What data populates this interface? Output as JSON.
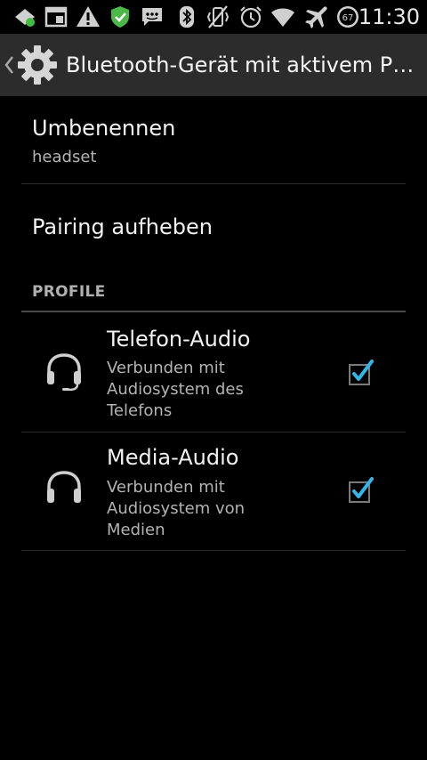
{
  "status_bar": {
    "time": "11:30",
    "battery_level": "67",
    "icons": [
      "notification-icon",
      "screenshot-icon",
      "warning-icon",
      "shield-icon",
      "messaging-icon",
      "bluetooth-icon",
      "vibrate-icon",
      "alarm-icon",
      "wifi-icon",
      "airplane-icon",
      "battery-icon"
    ]
  },
  "action_bar": {
    "title": "Bluetooth-Gerät mit aktivem P…"
  },
  "rename": {
    "title": "Umbenennen",
    "summary": "headset"
  },
  "unpair": {
    "title": "Pairing aufheben"
  },
  "profiles": {
    "category_label": "PROFILE",
    "items": [
      {
        "title": "Telefon-Audio",
        "summary": "Verbunden mit\nAudiosystem des\nTelefons",
        "icon": "headset-icon",
        "checked": true
      },
      {
        "title": "Media-Audio",
        "summary": "Verbunden mit\nAudiosystem von\nMedien",
        "icon": "headphones-icon",
        "checked": true
      }
    ]
  },
  "colors": {
    "action_bar_bg": "#2c2c2c",
    "accent_check": "#33b5e5",
    "background": "#000000"
  }
}
